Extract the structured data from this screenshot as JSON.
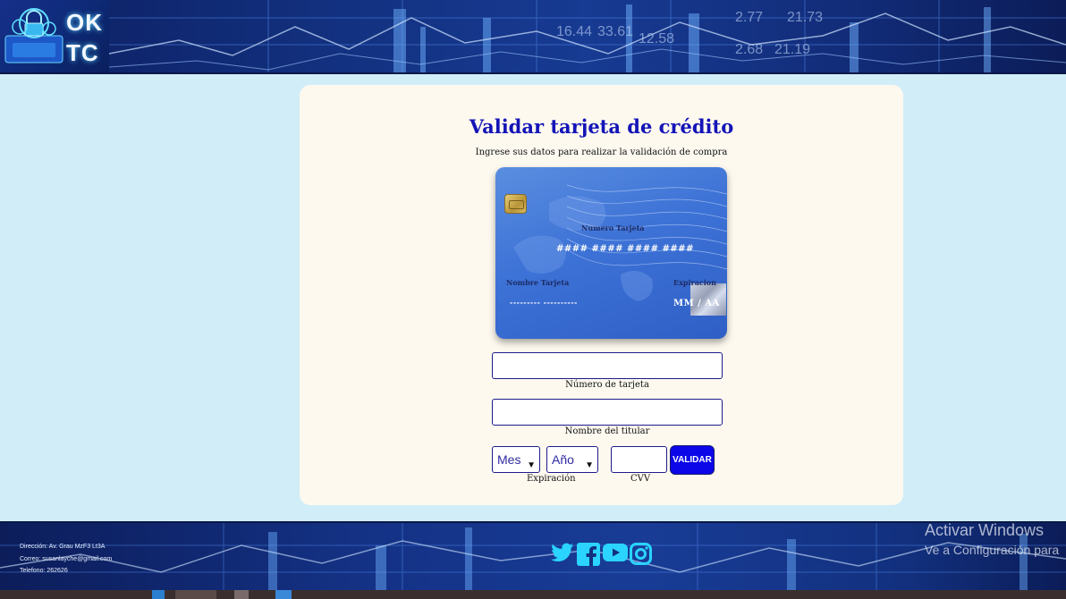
{
  "header": {
    "logo_line1": "OK",
    "logo_line2": "TC",
    "bg_numbers": [
      "16.44",
      "33.61",
      "12.58",
      "2.77",
      "21.73",
      "2.68",
      "21.19"
    ]
  },
  "form": {
    "title": "Validar tarjeta de crédito",
    "subtitle": "Ingrese sus datos para realizar la validación de compra",
    "card_preview": {
      "number_label": "Numero Tarjeta",
      "number_value": "#### #### #### ####",
      "name_label": "Nombre Tarjeta",
      "name_value": "--------- ----------",
      "expiry_label": "Expiracion",
      "expiry_value": "MM / AA"
    },
    "card_number_caption": "Número de tarjeta",
    "card_number_value": "",
    "holder_name_caption": "Nombre del titular",
    "holder_name_value": "",
    "month_select": "Mes",
    "year_select": "Año",
    "expiry_caption": "Expiración",
    "cvv_caption": "CVV",
    "cvv_value": "",
    "validate_button": "VALIDAR"
  },
  "footer": {
    "address": "Dirección: Av. Grau MzF3 Lt3A",
    "email": "Correo: susanlayche@gmail.com",
    "phone": "Telefono: 262626",
    "social_icons": [
      "twitter-icon",
      "facebook-icon",
      "youtube-icon",
      "instagram-icon"
    ]
  },
  "watermark": {
    "line1": "Activar Windows",
    "line2": "Ve a Configuración para"
  },
  "colors": {
    "page_bg": "#d1eef8",
    "panel_bg": "#fdf9ef",
    "title": "#1414b8",
    "button": "#0b07e8",
    "social": "#2ad4ff"
  }
}
